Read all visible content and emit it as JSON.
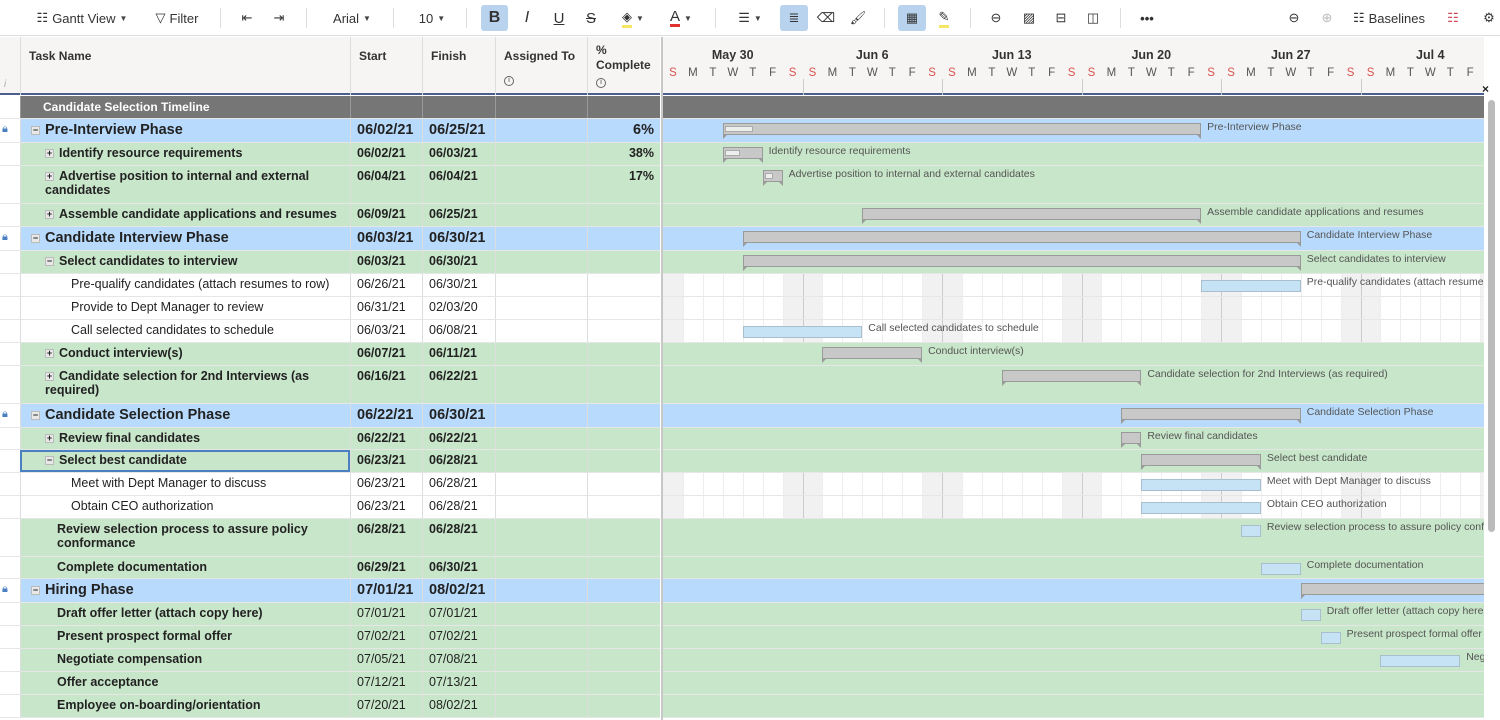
{
  "toolbar": {
    "view_label": "Gantt View",
    "filter_label": "Filter",
    "font": "Arial",
    "font_size": "10",
    "baselines_label": "Baselines",
    "fill_color": "#f5e663",
    "text_color": "#e03030"
  },
  "columns": {
    "task": "Task Name",
    "start": "Start",
    "finish": "Finish",
    "assigned": "Assigned To",
    "pct": "% Complete"
  },
  "gantt": {
    "weeks": [
      "May 30",
      "Jun 6",
      "Jun 13",
      "Jun 20",
      "Jun 27",
      "Jul 4"
    ],
    "days": [
      "S",
      "M",
      "T",
      "W",
      "T",
      "F",
      "S"
    ],
    "timeline_start": "2021-05-30",
    "close": "×"
  },
  "colors": {
    "title": "#767676",
    "phase": "#b8dbfd",
    "parent": "#c8e6c9",
    "leaf": "#ffffff",
    "weekend": "#d9534f"
  },
  "rows": [
    {
      "name": "Candidate Selection Timeline",
      "type": "title",
      "start": "",
      "finish": "",
      "pct": "",
      "h": 23
    },
    {
      "name": "Pre-Interview Phase",
      "type": "phase",
      "expand": "-",
      "start": "06/02/21",
      "finish": "06/25/21",
      "pct": "6%",
      "progress": 0.06,
      "bar": "summary",
      "lock": true,
      "h": 24
    },
    {
      "name": "Identify resource requirements",
      "type": "parent",
      "level": 1,
      "expand": "+",
      "start": "06/02/21",
      "finish": "06/03/21",
      "pct": "38%",
      "progress": 0.38,
      "bar": "summary",
      "h": 23
    },
    {
      "name": "Advertise position to internal and external candidates",
      "type": "parent",
      "level": 1,
      "expand": "+",
      "start": "06/04/21",
      "finish": "06/04/21",
      "pct": "17%",
      "progress": 0.17,
      "bar": "summary",
      "h": 38
    },
    {
      "name": "Assemble candidate applications and resumes",
      "type": "parent",
      "level": 1,
      "expand": "+",
      "start": "06/09/21",
      "finish": "06/25/21",
      "pct": "",
      "bar": "summary",
      "h": 23
    },
    {
      "name": "Candidate Interview Phase",
      "type": "phase",
      "expand": "-",
      "start": "06/03/21",
      "finish": "06/30/21",
      "pct": "",
      "bar": "summary",
      "lock": true,
      "h": 24
    },
    {
      "name": "Select candidates to interview",
      "type": "parent",
      "level": 1,
      "expand": "-",
      "start": "06/03/21",
      "finish": "06/30/21",
      "pct": "",
      "bar": "summary",
      "h": 23
    },
    {
      "name": "Pre-qualify candidates (attach resumes to row)",
      "type": "leaf",
      "level": 2,
      "start": "06/26/21",
      "finish": "06/30/21",
      "pct": "",
      "bar": "task",
      "h": 23
    },
    {
      "name": "Provide to Dept Manager to review",
      "type": "leaf",
      "level": 2,
      "start": "06/31/21",
      "finish": "02/03/20",
      "pct": "",
      "bar": "none",
      "h": 23
    },
    {
      "name": "Call selected candidates to schedule",
      "type": "leaf",
      "level": 2,
      "start": "06/03/21",
      "finish": "06/08/21",
      "pct": "",
      "bar": "task",
      "h": 23
    },
    {
      "name": "Conduct interview(s)",
      "type": "parent",
      "level": 1,
      "expand": "+",
      "start": "06/07/21",
      "finish": "06/11/21",
      "pct": "",
      "bar": "summary",
      "h": 23
    },
    {
      "name": "Candidate selection for 2nd Interviews (as required)",
      "type": "parent",
      "level": 1,
      "expand": "+",
      "start": "06/16/21",
      "finish": "06/22/21",
      "pct": "",
      "bar": "summary",
      "h": 38
    },
    {
      "name": "Candidate Selection Phase",
      "type": "phase",
      "expand": "-",
      "start": "06/22/21",
      "finish": "06/30/21",
      "pct": "",
      "bar": "summary",
      "lock": true,
      "h": 24
    },
    {
      "name": "Review final candidates",
      "type": "parent",
      "level": 1,
      "expand": "+",
      "start": "06/22/21",
      "finish": "06/22/21",
      "pct": "",
      "bar": "summary",
      "h": 22
    },
    {
      "name": "Select best candidate",
      "type": "parent",
      "level": 1,
      "expand": "-",
      "start": "06/23/21",
      "finish": "06/28/21",
      "pct": "",
      "bar": "summary",
      "selected": true,
      "h": 23
    },
    {
      "name": "Meet with Dept Manager to discuss",
      "type": "leaf",
      "level": 2,
      "start": "06/23/21",
      "finish": "06/28/21",
      "pct": "",
      "bar": "task",
      "h": 23
    },
    {
      "name": "Obtain CEO authorization",
      "type": "leaf",
      "level": 2,
      "start": "06/23/21",
      "finish": "06/28/21",
      "pct": "",
      "bar": "task",
      "h": 23
    },
    {
      "name": "Review selection process to assure policy conformance",
      "type": "parent",
      "level": 1,
      "start": "06/28/21",
      "finish": "06/28/21",
      "pct": "",
      "bar": "task",
      "h": 38
    },
    {
      "name": "Complete documentation",
      "type": "parent",
      "level": 1,
      "start": "06/29/21",
      "finish": "06/30/21",
      "pct": "",
      "bar": "task",
      "h": 22
    },
    {
      "name": "Hiring Phase",
      "type": "phase",
      "expand": "-",
      "start": "07/01/21",
      "finish": "08/02/21",
      "pct": "",
      "bar": "summary",
      "lock": true,
      "nolabel": true,
      "h": 24
    },
    {
      "name": "Draft offer letter (attach copy here)",
      "type": "parent",
      "level": 1,
      "start": "07/01/21",
      "finish": "07/01/21",
      "pct": "",
      "bar": "task",
      "plaindates": true,
      "h": 23
    },
    {
      "name": "Present prospect formal offer",
      "type": "parent",
      "level": 1,
      "start": "07/02/21",
      "finish": "07/02/21",
      "pct": "",
      "bar": "task",
      "plaindates": true,
      "h": 23
    },
    {
      "name": "Negotiate compensation",
      "type": "parent",
      "level": 1,
      "start": "07/05/21",
      "finish": "07/08/21",
      "pct": "",
      "bar": "task",
      "plaindates": true,
      "h": 23
    },
    {
      "name": "Offer acceptance",
      "type": "parent",
      "level": 1,
      "start": "07/12/21",
      "finish": "07/13/21",
      "pct": "",
      "bar": "task",
      "plaindates": true,
      "h": 23
    },
    {
      "name": "Employee on-boarding/orientation",
      "type": "parent",
      "level": 1,
      "start": "07/20/21",
      "finish": "08/02/21",
      "pct": "",
      "bar": "task",
      "plaindates": true,
      "h": 23
    }
  ]
}
